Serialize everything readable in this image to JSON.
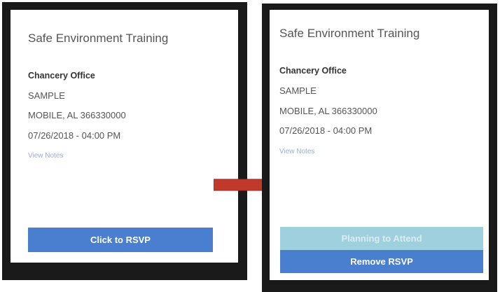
{
  "before": {
    "event_title": "Safe Environment Training",
    "location_name": "Chancery Office",
    "address_line1": "SAMPLE",
    "address_line2": "MOBILE, AL 366330000",
    "datetime": "07/26/2018 - 04:00 PM",
    "notes_link": "View Notes",
    "rsvp_button": "Click to RSVP"
  },
  "after": {
    "event_title": "Safe Environment Training",
    "location_name": "Chancery Office",
    "address_line1": "SAMPLE",
    "address_line2": "MOBILE, AL 366330000",
    "datetime": "07/26/2018 - 04:00 PM",
    "notes_link": "View Notes",
    "attend_button": "Planning to Attend",
    "remove_button": "Remove RSVP"
  },
  "colors": {
    "primary_button": "#4a7fd0",
    "secondary_button": "#9fd0de",
    "arrow": "#c0392b"
  }
}
